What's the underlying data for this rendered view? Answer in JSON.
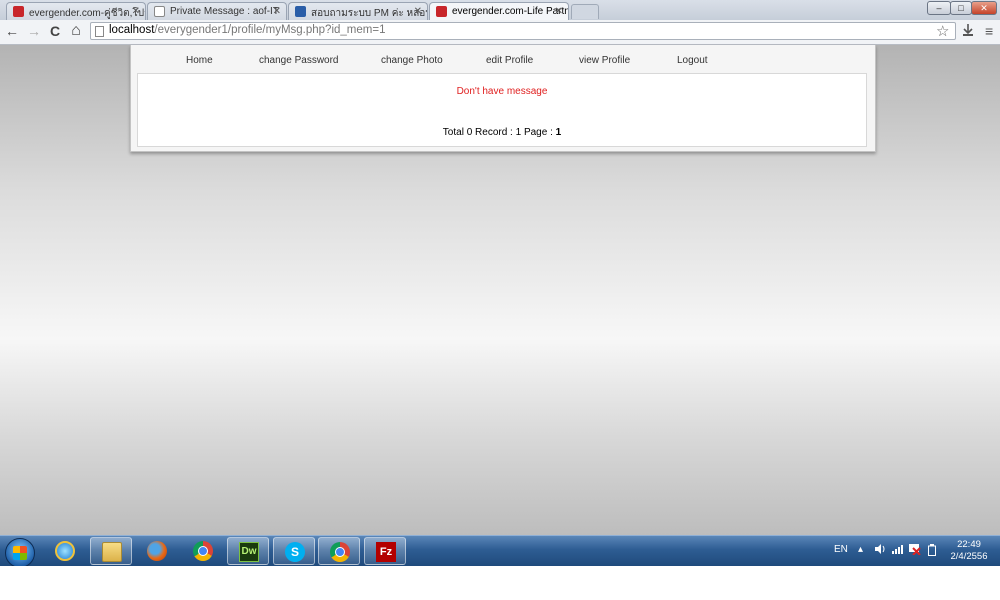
{
  "browser": {
    "tabs": [
      {
        "title": "evergender.com-คู่ชีวิต,โปรด",
        "favicon_color": "#c8262b",
        "active": false
      },
      {
        "title": "Private Message : aof-IT",
        "favicon_color": "#ffffff",
        "active": false
      },
      {
        "title": "สอบถามระบบ PM ค่ะ หลอนคั่ง",
        "favicon_color": "#2a5ea8",
        "active": false
      },
      {
        "title": "evergender.com-Life Partner",
        "favicon_color": "#c8262b",
        "active": true
      }
    ],
    "tab_close_glyph": "✕",
    "window_controls": {
      "minimize": "–",
      "maximize": "□",
      "close": "✕"
    },
    "nav": {
      "back": "←",
      "forward": "→",
      "reload": "C",
      "home": "⌂"
    },
    "address": {
      "host": "localhost",
      "path": "/everygender1/profile/myMsg.php?id_mem=1"
    },
    "bookmark_star": "☆",
    "menu_glyph": "≡"
  },
  "page": {
    "menu": [
      {
        "label": "Home"
      },
      {
        "label": "change Password"
      },
      {
        "label": "change Photo"
      },
      {
        "label": "edit Profile"
      },
      {
        "label": "view Profile"
      },
      {
        "label": "Logout"
      }
    ],
    "message": "Don't have message",
    "pager": {
      "prefix": "Total 0 Record : 1 Page : ",
      "current": "1"
    },
    "accent_color": "#e02020"
  },
  "taskbar": {
    "apps": [
      {
        "name": "internet-explorer"
      },
      {
        "name": "windows-explorer"
      },
      {
        "name": "firefox"
      },
      {
        "name": "chrome"
      },
      {
        "name": "dreamweaver",
        "label": "Dw"
      },
      {
        "name": "skype",
        "label": "S"
      },
      {
        "name": "chrome-active"
      },
      {
        "name": "filezilla",
        "label": "Fz"
      }
    ],
    "language": "EN",
    "time": "22:49",
    "date": "2/4/2556"
  }
}
